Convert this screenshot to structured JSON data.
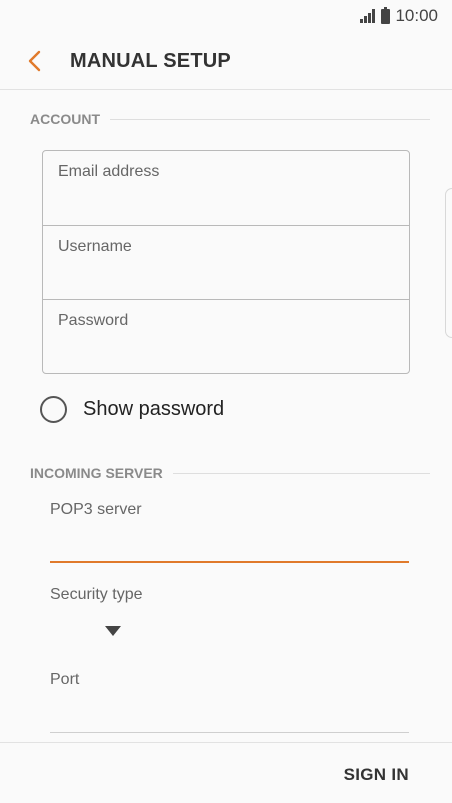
{
  "status": {
    "time": "10:00"
  },
  "header": {
    "title": "MANUAL SETUP",
    "back_icon": "chevron-left-icon",
    "accent": "#e07a2b"
  },
  "account": {
    "section_title": "ACCOUNT",
    "fields": [
      {
        "label": "Email address"
      },
      {
        "label": "Username"
      },
      {
        "label": "Password"
      }
    ],
    "show_password": {
      "label": "Show password",
      "checked": false
    }
  },
  "incoming": {
    "section_title": "INCOMING SERVER",
    "server_label": "POP3 server",
    "security_label": "Security type",
    "port_label": "Port"
  },
  "footer": {
    "sign_in": "SIGN IN"
  }
}
